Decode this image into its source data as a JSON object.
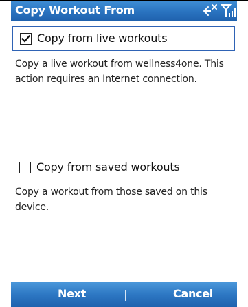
{
  "title_bar": {
    "title": "Copy Workout From",
    "icons": [
      "connectivity-off-icon",
      "signal-strength-icon"
    ]
  },
  "options": [
    {
      "label": "Copy from live workouts",
      "checked": true,
      "description": "Copy a live workout from wellness4one. This action requires an Internet connection."
    },
    {
      "label": "Copy from saved workouts",
      "checked": false,
      "description": "Copy a workout from those saved on this device."
    }
  ],
  "softkeys": {
    "left": "Next",
    "right": "Cancel"
  },
  "colors": {
    "bar_blue": "#2a73c0",
    "selection_border": "#2f63b5",
    "text": "#222222"
  }
}
